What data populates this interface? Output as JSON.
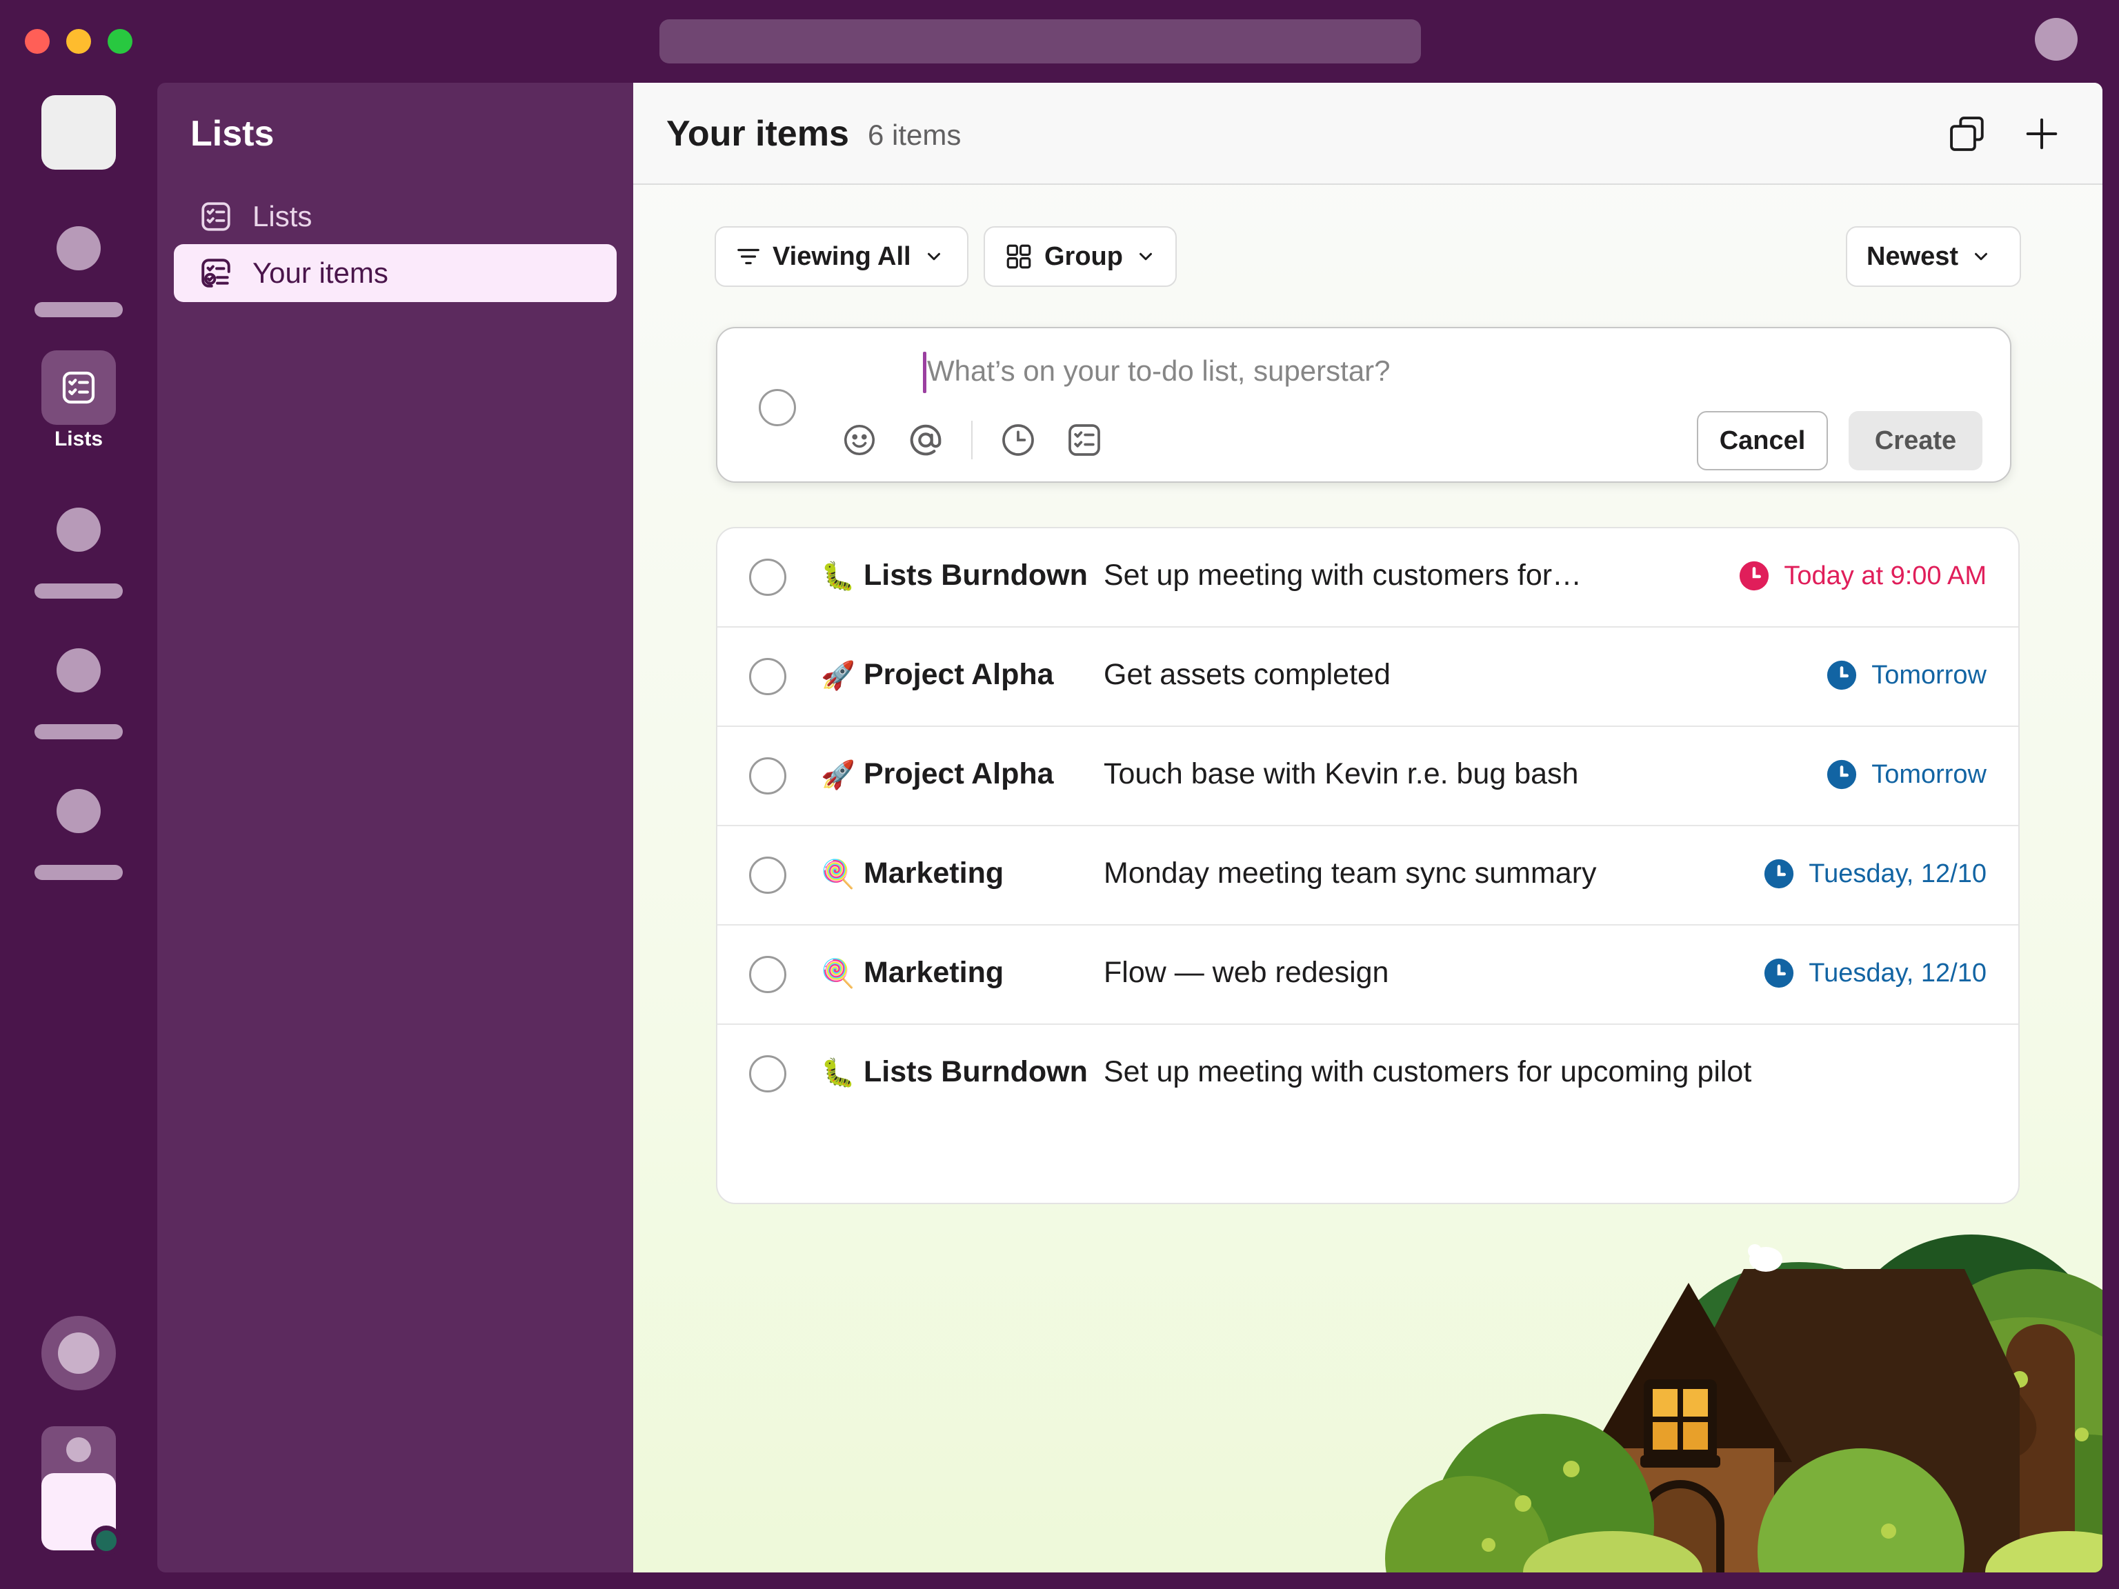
{
  "window": {
    "title": ""
  },
  "rail": {
    "active_label": "Lists"
  },
  "sidebar": {
    "title": "Lists",
    "items": [
      {
        "label": "Lists",
        "icon": "list-icon"
      },
      {
        "label": "Your items",
        "icon": "your-items-icon"
      }
    ]
  },
  "header": {
    "title": "Your items",
    "count": "6 items",
    "actions": [
      "new-window-icon",
      "plus-icon"
    ]
  },
  "filters": {
    "viewing": "Viewing All",
    "group": "Group",
    "sort": "Newest"
  },
  "composer": {
    "placeholder": "What’s on your to-do list, superstar?",
    "cancel_label": "Cancel",
    "create_label": "Create",
    "tools": [
      "emoji-icon",
      "mention-icon",
      "clock-icon",
      "checklist-icon"
    ]
  },
  "items": [
    {
      "emoji": "🐛",
      "list": "Lists Burndown",
      "task": "Set up meeting with customers for…",
      "due": "Today at 9:00 AM",
      "due_color": "#e01e5a"
    },
    {
      "emoji": "🚀",
      "list": "Project Alpha",
      "task": "Get assets completed",
      "due": "Tomorrow",
      "due_color": "#1264a3"
    },
    {
      "emoji": "🚀",
      "list": "Project Alpha",
      "task": "Touch base with Kevin r.e. bug bash",
      "due": "Tomorrow",
      "due_color": "#1264a3"
    },
    {
      "emoji": "🍭",
      "list": "Marketing",
      "task": "Monday meeting team sync summary",
      "due": "Tuesday, 12/10",
      "due_color": "#1264a3"
    },
    {
      "emoji": "🍭",
      "list": "Marketing",
      "task": "Flow — web redesign",
      "due": "Tuesday, 12/10",
      "due_color": "#1264a3"
    },
    {
      "emoji": "🐛",
      "list": "Lists Burndown",
      "task": "Set up meeting with customers for upcoming pilot",
      "due": "",
      "due_color": "#1264a3"
    }
  ],
  "colors": {
    "aubergine": "#4a154b",
    "sidebar": "#5c2a5e",
    "overdue": "#e01e5a",
    "upcoming": "#1264a3"
  }
}
